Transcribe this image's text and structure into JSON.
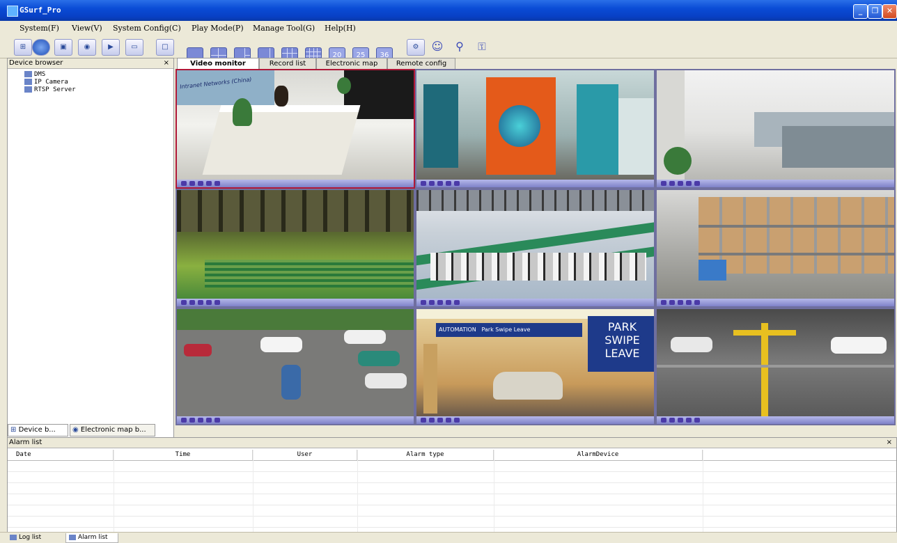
{
  "window": {
    "title": "GSurf_Pro"
  },
  "menu": [
    "System(F)",
    "View(V)",
    "System Config(C)",
    "Play Mode(P)",
    "Manage Tool(G)",
    "Help(H)"
  ],
  "toolbar": {
    "left_icons": [
      "device-tree-icon",
      "globe-icon",
      "monitor-icon",
      "camera-record-icon",
      "playback-icon",
      "window-icon"
    ],
    "layouts": [
      "1",
      "4",
      "6",
      "8",
      "9",
      "16",
      "20",
      "25",
      "36"
    ],
    "right_icons": [
      "settings-icon",
      "user-icon",
      "search-icon",
      "lock-icon"
    ]
  },
  "left_panel": {
    "title": "Device browser",
    "close": "×",
    "tree": [
      "DMS",
      "IP Camera",
      "RTSP Server"
    ],
    "tabs": [
      "Device b...",
      "Electronic map b..."
    ]
  },
  "tabs": [
    "Video monitor",
    "Record list",
    "Electronic map",
    "Remote config"
  ],
  "active_tab": 0,
  "cameras": [
    {
      "scene": "reception"
    },
    {
      "scene": "lobby"
    },
    {
      "scene": "office"
    },
    {
      "scene": "warehouse"
    },
    {
      "scene": "factory"
    },
    {
      "scene": "storage"
    },
    {
      "scene": "parking-lot"
    },
    {
      "scene": "parking-garage"
    },
    {
      "scene": "parking-rack"
    }
  ],
  "scene_text": {
    "cam1_sign": "Intranet Networks (China)",
    "cam8_sign_left": "AUTOMATION",
    "cam8_sign_right": "Park Swipe Leave",
    "cam8_big": [
      "PARK",
      "SWIPE",
      "LEAVE"
    ]
  },
  "alarm_list": {
    "title": "Alarm list",
    "close": "×",
    "columns": [
      "Date",
      "Time",
      "User",
      "Alarm type",
      "AlarmDevice"
    ]
  },
  "status_tabs": [
    "Log list",
    "Alarm list"
  ],
  "colors": {
    "title_bar": "#0a4cd6",
    "selected_cell": "#b01838",
    "cell_bar": "#8f92d6"
  }
}
